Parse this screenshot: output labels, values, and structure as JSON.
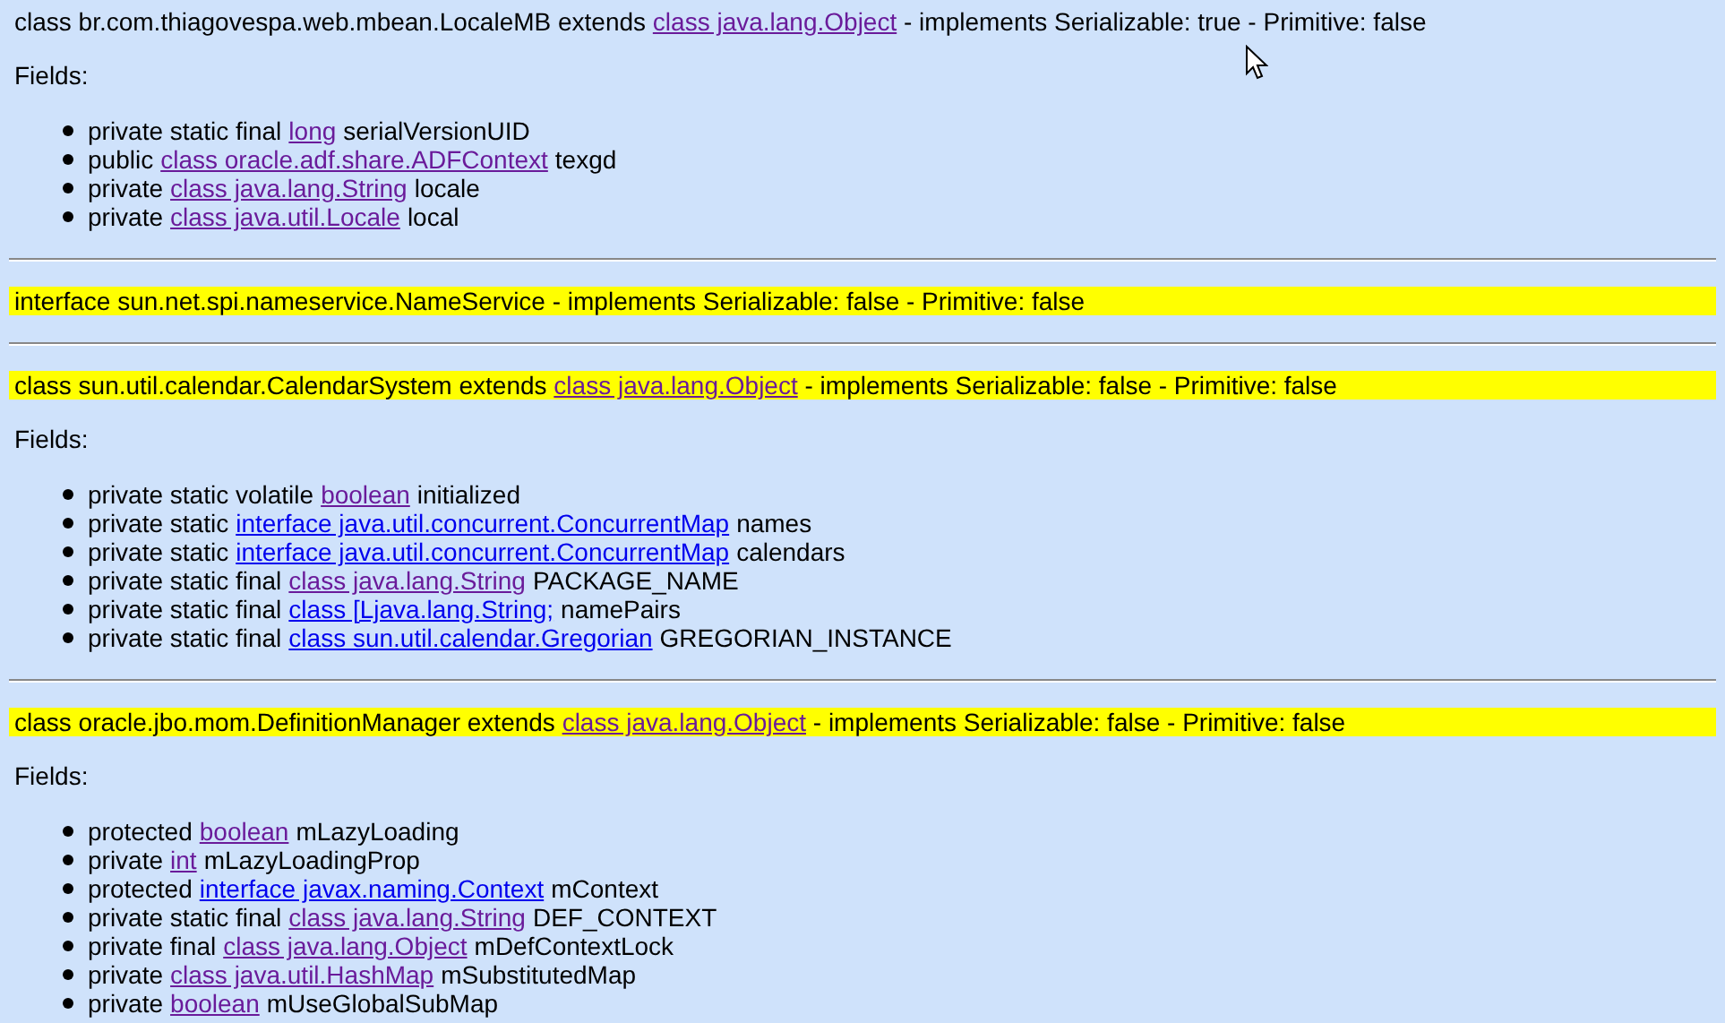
{
  "classes": [
    {
      "highlighted": false,
      "header": [
        {
          "text": "class br.com.thiagovespa.web.mbean.LocaleMB extends "
        },
        {
          "text": "class java.lang.Object",
          "link": true,
          "visited": true
        },
        {
          "text": " - implements Serializable: true - Primitive: false"
        }
      ],
      "fields_label": "Fields:",
      "fields": [
        {
          "modifiers": "private static final",
          "type": {
            "text": "long",
            "visited": true
          },
          "name": "serialVersionUID"
        },
        {
          "modifiers": "public",
          "type": {
            "text": "class oracle.adf.share.ADFContext",
            "visited": true
          },
          "name": "texgd"
        },
        {
          "modifiers": "private",
          "type": {
            "text": "class java.lang.String",
            "visited": true
          },
          "name": "locale"
        },
        {
          "modifiers": "private",
          "type": {
            "text": "class java.util.Locale",
            "visited": true
          },
          "name": "local"
        }
      ]
    },
    {
      "highlighted": true,
      "header": [
        {
          "text": "interface sun.net.spi.nameservice.NameService - implements Serializable: false - Primitive: false"
        }
      ]
    },
    {
      "highlighted": true,
      "header": [
        {
          "text": "class sun.util.calendar.CalendarSystem extends "
        },
        {
          "text": "class java.lang.Object",
          "link": true,
          "visited": true
        },
        {
          "text": " - implements Serializable: false - Primitive: false"
        }
      ],
      "fields_label": "Fields:",
      "fields": [
        {
          "modifiers": "private static volatile",
          "type": {
            "text": "boolean",
            "visited": true
          },
          "name": "initialized"
        },
        {
          "modifiers": "private static",
          "type": {
            "text": "interface java.util.concurrent.ConcurrentMap",
            "visited": false
          },
          "name": "names"
        },
        {
          "modifiers": "private static",
          "type": {
            "text": "interface java.util.concurrent.ConcurrentMap",
            "visited": false
          },
          "name": "calendars"
        },
        {
          "modifiers": "private static final",
          "type": {
            "text": "class java.lang.String",
            "visited": true
          },
          "name": "PACKAGE_NAME"
        },
        {
          "modifiers": "private static final",
          "type": {
            "text": "class [Ljava.lang.String;",
            "visited": false
          },
          "name": "namePairs"
        },
        {
          "modifiers": "private static final",
          "type": {
            "text": "class sun.util.calendar.Gregorian",
            "visited": false
          },
          "name": "GREGORIAN_INSTANCE"
        }
      ]
    },
    {
      "highlighted": true,
      "header": [
        {
          "text": "class oracle.jbo.mom.DefinitionManager extends "
        },
        {
          "text": "class java.lang.Object",
          "link": true,
          "visited": true
        },
        {
          "text": " - implements Serializable: false - Primitive: false"
        }
      ],
      "fields_label": "Fields:",
      "fields": [
        {
          "modifiers": "protected",
          "type": {
            "text": "boolean",
            "visited": true
          },
          "name": "mLazyLoading"
        },
        {
          "modifiers": "private",
          "type": {
            "text": "int",
            "visited": true
          },
          "name": "mLazyLoadingProp"
        },
        {
          "modifiers": "protected",
          "type": {
            "text": "interface javax.naming.Context",
            "visited": false
          },
          "name": "mContext"
        },
        {
          "modifiers": "private static final",
          "type": {
            "text": "class java.lang.String",
            "visited": true
          },
          "name": "DEF_CONTEXT"
        },
        {
          "modifiers": "private final",
          "type": {
            "text": "class java.lang.Object",
            "visited": true
          },
          "name": "mDefContextLock"
        },
        {
          "modifiers": "private",
          "type": {
            "text": "class java.util.HashMap",
            "visited": true
          },
          "name": "mSubstitutedMap"
        },
        {
          "modifiers": "private",
          "type": {
            "text": "boolean",
            "visited": true
          },
          "name": "mUseGlobalSubMap"
        }
      ]
    }
  ]
}
